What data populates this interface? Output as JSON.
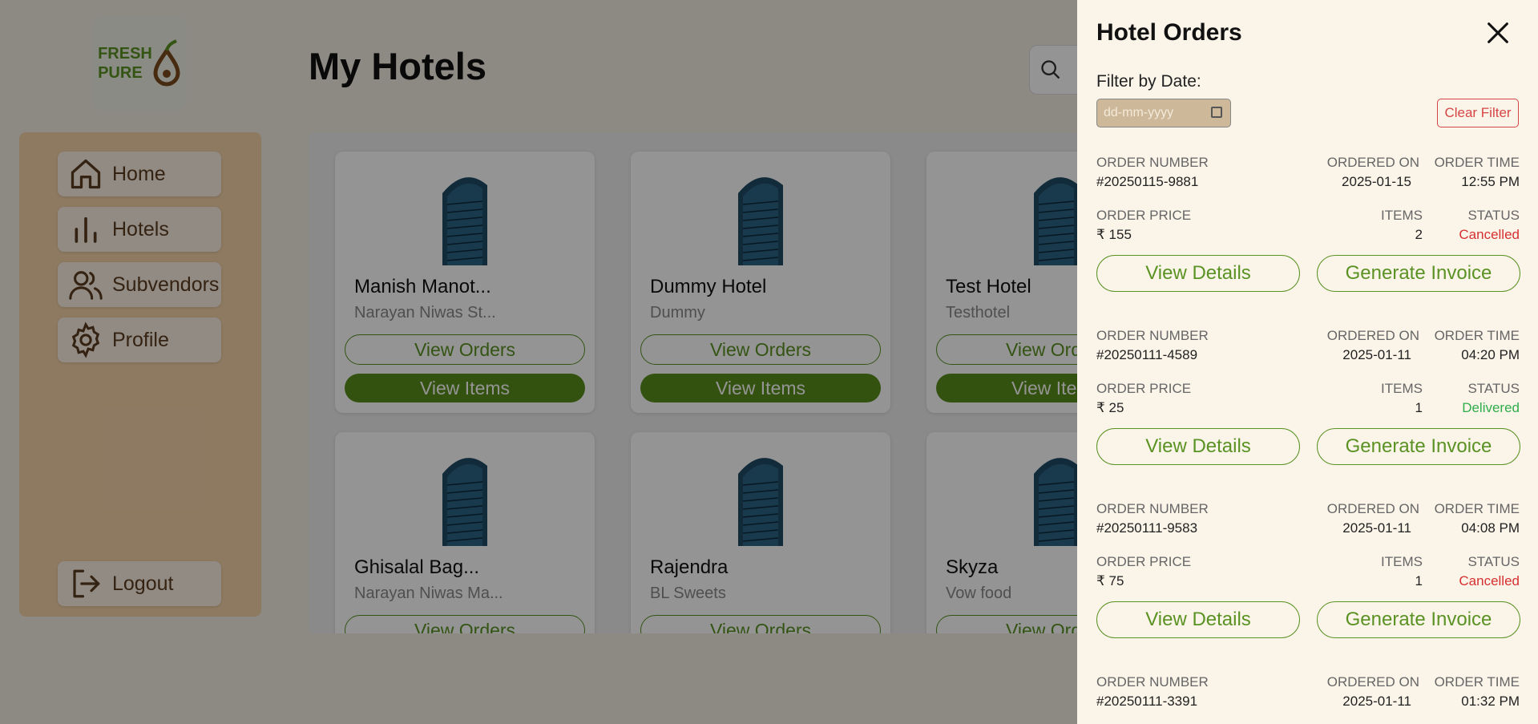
{
  "brand": {
    "logo_line1": "FRESH",
    "logo_line2": "PURE"
  },
  "sidebar": {
    "items": [
      {
        "label": "Home",
        "icon": "home-icon"
      },
      {
        "label": "Hotels",
        "icon": "bar-chart-icon"
      },
      {
        "label": "Subvendors",
        "icon": "users-icon"
      },
      {
        "label": "Profile",
        "icon": "gear-icon"
      }
    ],
    "logout": {
      "label": "Logout",
      "icon": "logout-icon"
    }
  },
  "main": {
    "title": "My Hotels",
    "search_icon": "search-icon",
    "view_orders_label": "View Orders",
    "view_items_label": "View Items",
    "hotels": [
      {
        "name": "Manish Manot...",
        "sub": "Narayan Niwas St..."
      },
      {
        "name": "Dummy Hotel",
        "sub": "Dummy"
      },
      {
        "name": "Test Hotel",
        "sub": "Testhotel"
      },
      {
        "name": "Ghisalal Bag...",
        "sub": "Narayan Niwas Ma..."
      },
      {
        "name": "Rajendra",
        "sub": "BL Sweets"
      },
      {
        "name": "Skyza",
        "sub": "Vow food"
      }
    ]
  },
  "panel": {
    "title": "Hotel Orders",
    "close_icon": "close-icon",
    "filter_label": "Filter by Date:",
    "date_placeholder": "dd-mm-yyyy",
    "clear_filter_label": "Clear Filter",
    "labels": {
      "order_number": "ORDER NUMBER",
      "ordered_on": "ORDERED ON",
      "order_time": "ORDER TIME",
      "order_price": "ORDER PRICE",
      "items": "ITEMS",
      "status": "STATUS"
    },
    "view_details_label": "View Details",
    "generate_invoice_label": "Generate Invoice",
    "orders": [
      {
        "number": "#20250115-9881",
        "date": "2025-01-15",
        "time": "12:55 PM",
        "price": "₹ 155",
        "items": "2",
        "status": "Cancelled"
      },
      {
        "number": "#20250111-4589",
        "date": "2025-01-11",
        "time": "04:20 PM",
        "price": "₹ 25",
        "items": "1",
        "status": "Delivered"
      },
      {
        "number": "#20250111-9583",
        "date": "2025-01-11",
        "time": "04:08 PM",
        "price": "₹ 75",
        "items": "1",
        "status": "Cancelled"
      },
      {
        "number": "#20250111-3391",
        "date": "2025-01-11",
        "time": "01:32 PM"
      }
    ]
  },
  "colors": {
    "accent": "#5a9223",
    "cancelled": "#d63031",
    "delivered": "#2fae4c",
    "sidebar_bg": "#f4d2a8"
  }
}
